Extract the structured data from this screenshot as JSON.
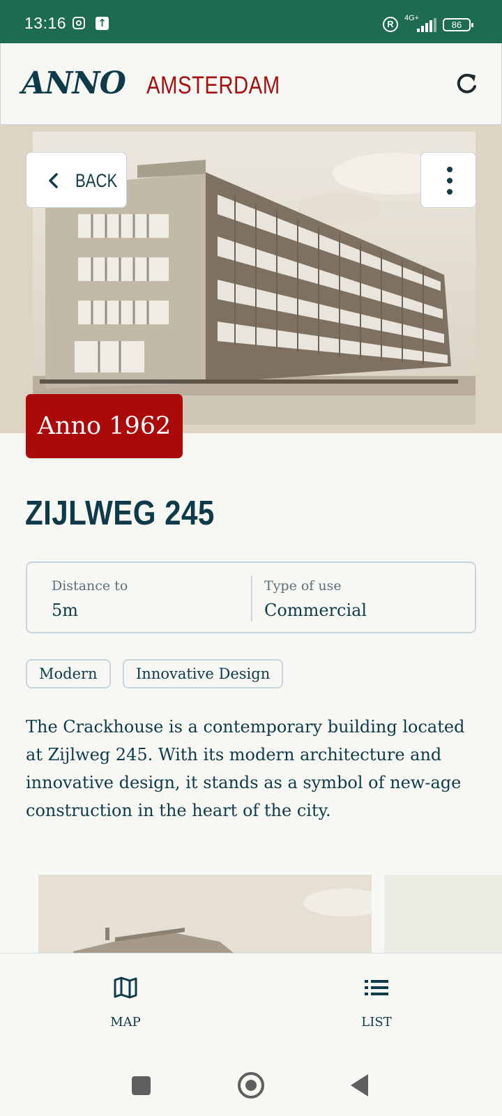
{
  "status_bar": {
    "time": "13:16",
    "network": "4G+",
    "battery": "86"
  },
  "header": {
    "logo_primary": "ANNO",
    "logo_secondary": "AMSTERDAM",
    "refresh_icon": "refresh-icon"
  },
  "hero": {
    "back_label": "BACK",
    "back_icon": "chevron-left-icon",
    "menu_icon": "more-vertical-icon",
    "year_badge": "Anno 1962"
  },
  "building": {
    "title": "ZIJLWEG 245",
    "info": [
      {
        "label": "Distance to",
        "value": "5m"
      },
      {
        "label": "Type of use",
        "value": "Commercial"
      }
    ],
    "tags": [
      "Modern",
      "Innovative Design"
    ],
    "description": "The Crackhouse is a contemporary building located at Zijlweg 245. With its modern architecture and innovative design, it stands as a symbol of new-age construction in the heart of the city."
  },
  "bottom_nav": {
    "items": [
      {
        "label": "MAP",
        "icon": "map-icon"
      },
      {
        "label": "LIST",
        "icon": "list-icon"
      }
    ]
  },
  "colors": {
    "status_bar": "#1e6b54",
    "primary_text": "#0f3a4a",
    "accent_red": "#ac0a0a",
    "border": "#c7d6dc",
    "background": "#f7f8f4"
  }
}
